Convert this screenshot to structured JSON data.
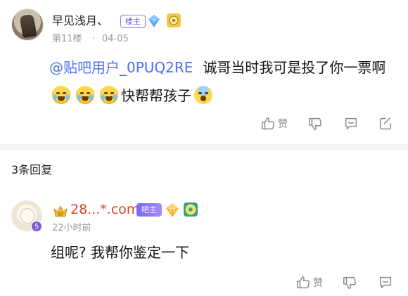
{
  "post": {
    "author": "早见浅月、",
    "role_badge": "楼主",
    "level": "8",
    "floor": "第11楼",
    "dot": "·",
    "date": "04-05",
    "mention": "@贴吧用户_0PUQ2RE",
    "text_part1": "诚哥当时我可是投了你一票啊",
    "text_part2": "快帮帮孩子",
    "emoji_names": [
      "crying-face-icon",
      "crying-face-icon",
      "crying-face-icon",
      "scared-face-icon"
    ],
    "actions": {
      "like_label": "赞"
    }
  },
  "replies_header": "3条回复",
  "reply": {
    "author": "28...*.com",
    "role_badge": "吧主",
    "avatar_level": "5",
    "crown_level": "10",
    "gem_level": "13",
    "time": "22小时前",
    "text": "组呢? 我帮你鉴定一下",
    "actions": {
      "like_label": "赞"
    }
  },
  "colors": {
    "accent_purple": "#6a5ae8",
    "mention_blue": "#4e6ef2",
    "username_orange": "#d24a1f",
    "muted_gray": "#9a9a9a"
  }
}
